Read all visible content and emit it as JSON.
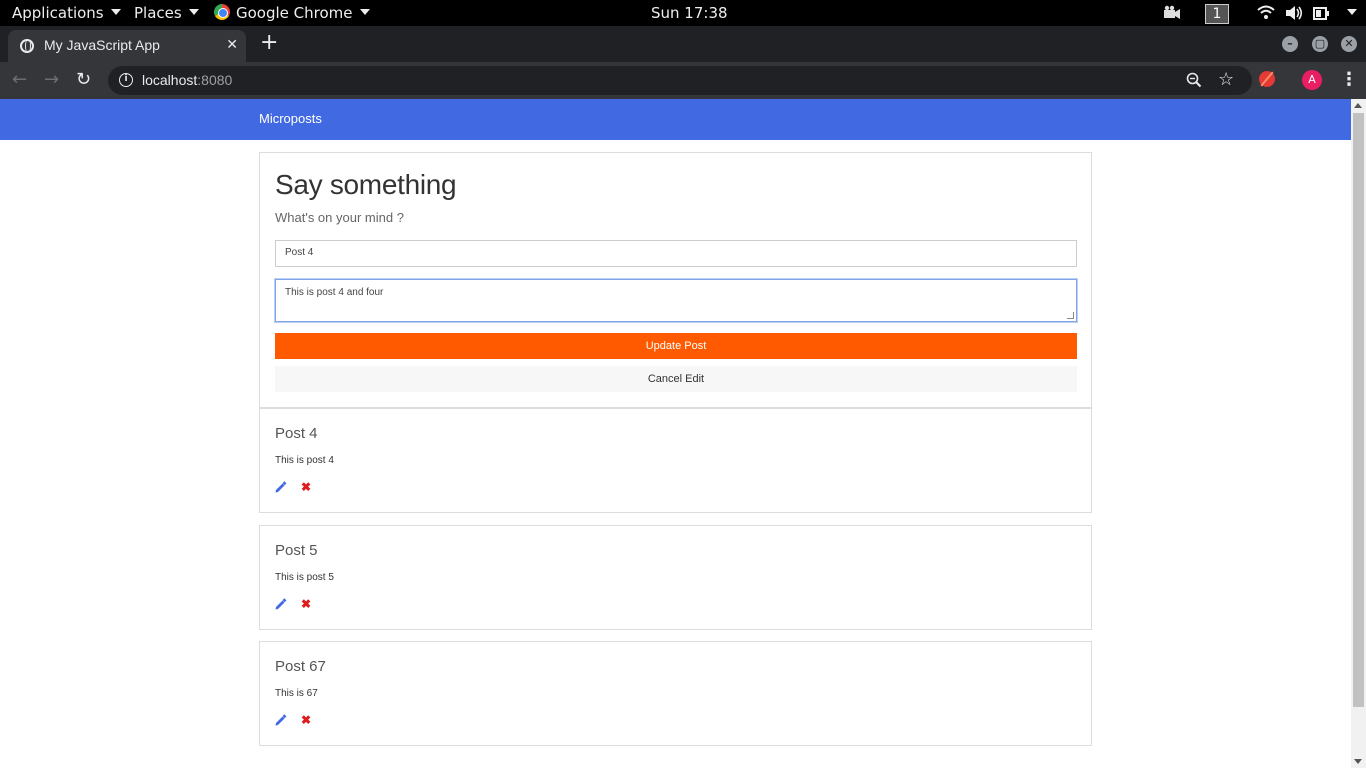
{
  "system_bar": {
    "applications": "Applications",
    "places": "Places",
    "active_app": "Google Chrome",
    "clock": "Sun 17:38",
    "workspace": "1"
  },
  "browser": {
    "tab_title": "My JavaScript App",
    "url_host": "localhost",
    "url_port": ":8080",
    "profile_initial": "A"
  },
  "app": {
    "brand": "Microposts",
    "form": {
      "heading": "Say something",
      "subheading": "What's on your mind ?",
      "title_value": "Post 4",
      "body_value": "This is post 4 and four",
      "update_label": "Update Post",
      "cancel_label": "Cancel Edit"
    },
    "posts": [
      {
        "title": "Post 4",
        "body": "This is post 4"
      },
      {
        "title": "Post 5",
        "body": "This is post 5"
      },
      {
        "title": "Post 67",
        "body": "This is 67"
      }
    ]
  },
  "colors": {
    "navbar": "#4169e1",
    "update_button": "#ff5a00",
    "delete_icon": "#e01b1b",
    "edit_icon": "#4169e1"
  }
}
